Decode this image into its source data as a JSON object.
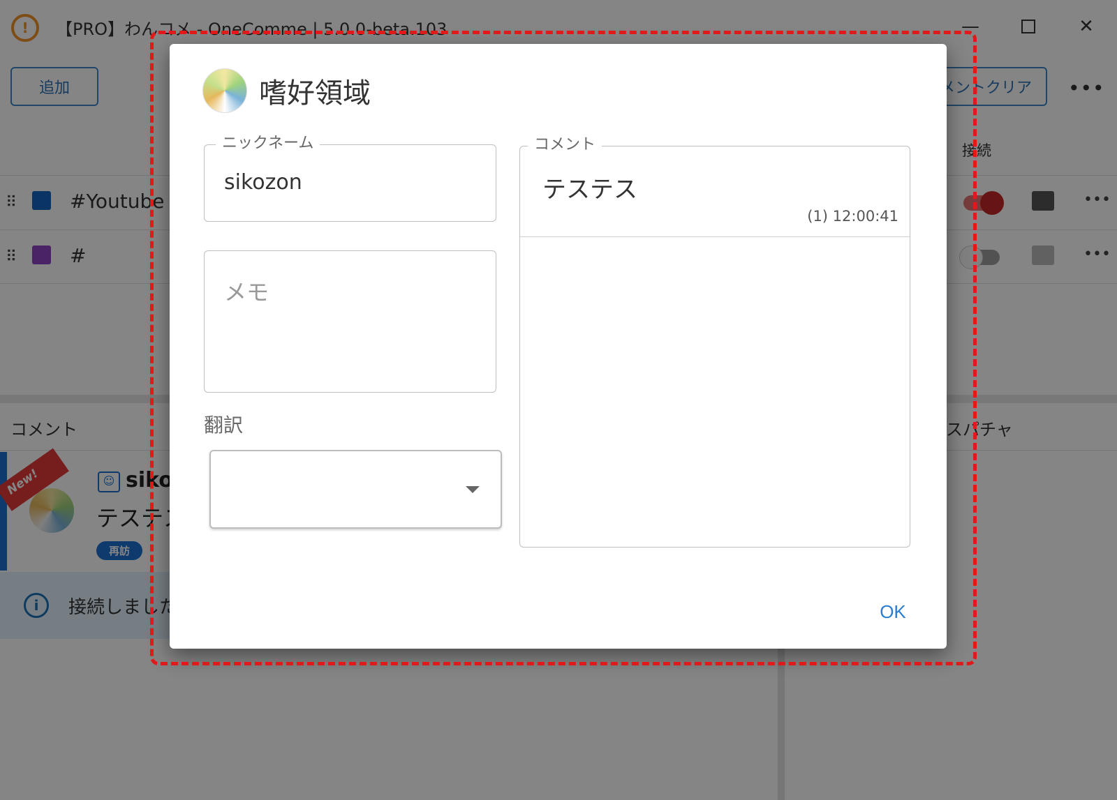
{
  "app": {
    "title": "【PRO】わんコメ - OneComme | 5.0.0-beta.103",
    "logo_icon": "onecomme-logo-icon",
    "window_controls": {
      "minimize": "—",
      "close": "✕"
    },
    "toolbar": {
      "add_label": "追加",
      "clear_label": "コメントクリア",
      "more_label": "•••"
    },
    "columns": {
      "connect": "接続"
    },
    "services": [
      {
        "label": "#Youtube",
        "color": "#1565c0",
        "connected": true
      },
      {
        "label": "#",
        "color": "#8e44c4",
        "connected": false
      }
    ],
    "comments_header": "コメント",
    "superchat_header": "スパチャ",
    "comment": {
      "new_badge": "New!",
      "user": "sikozon",
      "text": "テステス",
      "badge": "再訪"
    },
    "info": {
      "text": "接続しました"
    },
    "colors": {
      "accent": "#2b7dd1",
      "toggle_on": "#c62828",
      "annotation": "#e01a1a"
    }
  },
  "dialog": {
    "title": "嗜好領域",
    "nickname": {
      "label": "ニックネーム",
      "value": "sikozon"
    },
    "memo": {
      "placeholder": "メモ"
    },
    "translation": {
      "label": "翻訳",
      "value": ""
    },
    "comments": {
      "label": "コメント",
      "items": [
        {
          "text": "テステス",
          "meta": "(1) 12:00:41"
        }
      ]
    },
    "ok_label": "OK"
  }
}
